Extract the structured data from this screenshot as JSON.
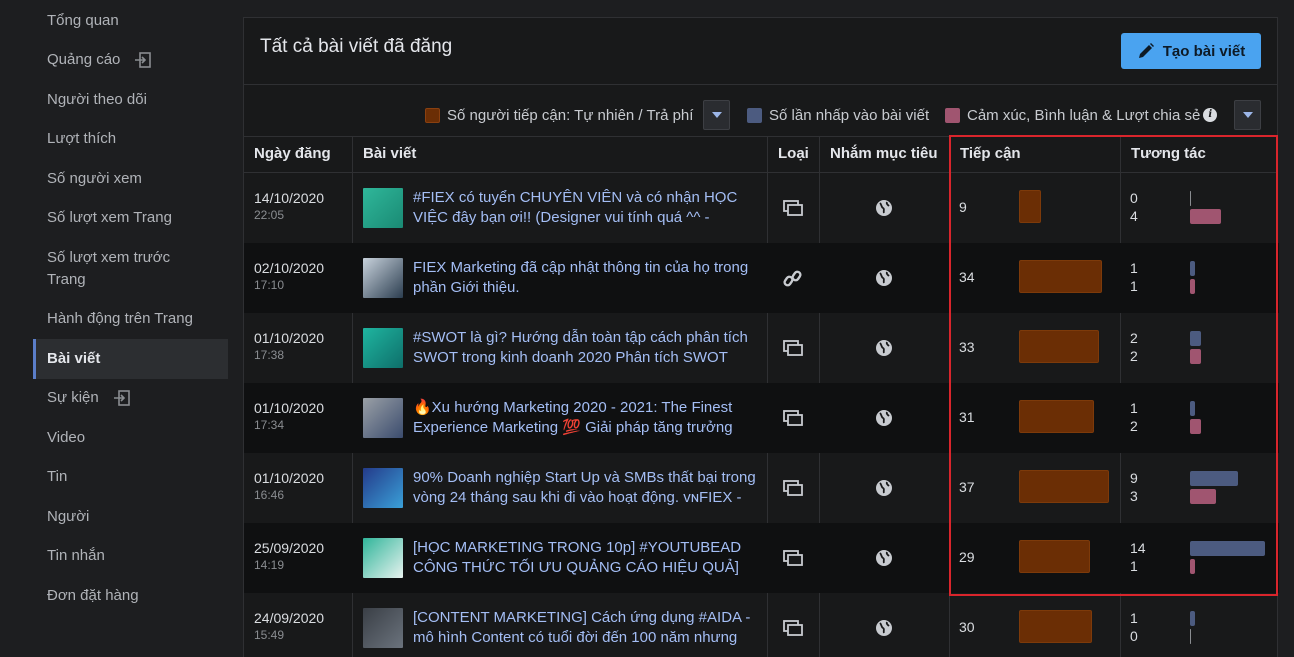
{
  "sidebar": {
    "items": [
      {
        "label": "Tổng quan",
        "exit": false,
        "active": false
      },
      {
        "label": "Quảng cáo",
        "exit": true,
        "active": false
      },
      {
        "label": "Người theo dõi",
        "exit": false,
        "active": false
      },
      {
        "label": "Lượt thích",
        "exit": false,
        "active": false
      },
      {
        "label": "Số người xem",
        "exit": false,
        "active": false
      },
      {
        "label": "Số lượt xem Trang",
        "exit": false,
        "active": false
      },
      {
        "label": "Số lượt xem trước Trang",
        "exit": false,
        "active": false
      },
      {
        "label": "Hành động trên Trang",
        "exit": false,
        "active": false
      },
      {
        "label": "Bài viết",
        "exit": false,
        "active": true
      },
      {
        "label": "Sự kiện",
        "exit": true,
        "active": false
      },
      {
        "label": "Video",
        "exit": false,
        "active": false
      },
      {
        "label": "Tin",
        "exit": false,
        "active": false
      },
      {
        "label": "Người",
        "exit": false,
        "active": false
      },
      {
        "label": "Tin nhắn",
        "exit": false,
        "active": false
      },
      {
        "label": "Đơn đặt hàng",
        "exit": false,
        "active": false
      }
    ]
  },
  "panel": {
    "title": "Tất cả bài viết đã đăng",
    "create_button": "Tạo bài viết"
  },
  "legend": {
    "reach_label": "Số người tiếp cận: Tự nhiên / Trả phí",
    "clicks_label": "Số lần nhấp vào bài viết",
    "reactions_label": "Cảm xúc, Bình luận & Lượt chia sẻ",
    "reach_color": "#6b2e05",
    "clicks_color": "#4c5b80",
    "reactions_color": "#a05570"
  },
  "table": {
    "headers": {
      "date": "Ngày đăng",
      "post": "Bài viết",
      "type": "Loại",
      "target": "Nhắm mục tiêu",
      "reach": "Tiếp cận",
      "engagement": "Tương tác"
    },
    "rows": [
      {
        "date": "14/10/2020",
        "time": "22:05",
        "text": "#FIEX có tuyển CHUYÊN VIÊN và có nhận HỌC VIỆC đây bạn ơi!! (Designer vui tính quá ^^ -",
        "type": "album",
        "reach": 9,
        "clicks": 0,
        "reactions": 4
      },
      {
        "date": "02/10/2020",
        "time": "17:10",
        "text": "FIEX Marketing đã cập nhật thông tin của họ trong phần Giới thiệu.",
        "type": "link",
        "reach": 34,
        "clicks": 1,
        "reactions": 1
      },
      {
        "date": "01/10/2020",
        "time": "17:38",
        "text": "#SWOT là gì? Hướng dẫn toàn tập cách phân tích SWOT trong kinh doanh 2020 Phân tích SWOT",
        "type": "album",
        "reach": 33,
        "clicks": 2,
        "reactions": 2
      },
      {
        "date": "01/10/2020",
        "time": "17:34",
        "text": "🔥Xu hướng Marketing 2020 - 2021: The Finest Experience Marketing 💯 Giải pháp tăng trưởng",
        "type": "album",
        "reach": 31,
        "clicks": 1,
        "reactions": 2
      },
      {
        "date": "01/10/2020",
        "time": "16:46",
        "text": "90% Doanh nghiệp Start Up và SMBs thất bại trong vòng 24 tháng sau khi đi vào hoạt động. ᴠɴFIEX -",
        "type": "album",
        "reach": 37,
        "clicks": 9,
        "reactions": 3
      },
      {
        "date": "25/09/2020",
        "time": "14:19",
        "text": "[HỌC MARKETING TRONG 10p] #YOUTUBEAD CÔNG THỨC TỐI ƯU QUẢNG CÁO HIỆU QUẢ]",
        "type": "album",
        "reach": 29,
        "clicks": 14,
        "reactions": 1
      },
      {
        "date": "24/09/2020",
        "time": "15:49",
        "text": "[CONTENT MARKETING] Cách ứng dụng #AIDA - mô hình Content có tuổi đời đến 100 năm nhưng",
        "type": "album",
        "reach": 30,
        "clicks": 1,
        "reactions": 0
      }
    ]
  }
}
